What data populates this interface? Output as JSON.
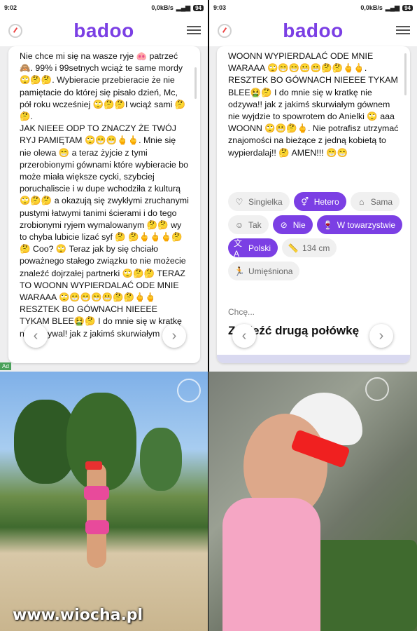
{
  "left": {
    "status": {
      "time": "9:02",
      "network": "0,0kB/s",
      "battery": "94"
    },
    "app_title": "badoo",
    "card_text": "Nie chce mi się na wasze ryje 🐽 patrzeć 🙈. 99% i 99setnych wciąż te same mordy 🙄🤔🤔. Wybieracie przebieracie że nie pamiętacie do której się pisało dzień, Mc, pół roku wcześniej 🙄🤔🤔I wciąż sami 🤔🤔.\nJAK NIEEE ODP TO ZNACZY ŻE TWÓJ RYJ PAMIĘTAM 🙄😁😁🖕🖕. Mnie się nie olewa 😁 a teraz żyjcie z tymi przerobionymi gównami które wybieracie bo może miała większe cycki, szybciej poruchaliscie i w dupe wchodziła z kulturą 🙄🤔🤔 a okazują się zwykłymi zruchanymi pustymi łatwymi tanimi ścierami i do tego zrobionymi ryjem wymalowanym 🤔🤔 wy to chyba lubicie lizać syf 🤔 🤔🖕🖕🖕🤔 🤔 Coo? 🙄 Teraz jak by się chciało poważnego stałego związku to nie możecie znaleźć dojrzałej partnerki 🙄🤔🤔 TERAZ TO WOONN WYPIERDALAĆ ODE MNIE WARAAA 🙄😁😁😁😬🤔🤔🖕🖕 RESZTEK BO GÓWNACH NIEEEE TYKAM BLEE🤮🤔 I do mnie się w kratkę nie odzywal! jak z jakimś skurwiałym",
    "ad_label": "Ad",
    "prev_icon": "chevron-left-icon",
    "next_icon": "chevron-right-icon"
  },
  "right": {
    "status": {
      "time": "9:03",
      "network": "0,0kB/s",
      "battery": "94"
    },
    "app_title": "badoo",
    "card_text": "WOONN WYPIERDALAĆ ODE MNIE WARAAA 🙄😁😁😬😬🤔🤔🖕🖕. RESZTEK BO GÓWNACH NIEEEE TYKAM BLEE🤮🤔 I do mnie się w kratkę nie odzywa!! jak z jakimś skurwiałym gównem nie wyjdzie to spowrotem do Anielki 🙄 aaa WOONN 🙄😬🤔🖕. Nie potrafisz utrzymać znajomości na bieżące z jedną kobietą to wypierdalaj!! 🤔 AMEN!!! 😁😁",
    "tags": [
      {
        "icon": "heart-icon",
        "glyph": "♡",
        "label": "Singielka",
        "active": false
      },
      {
        "icon": "gender-icon",
        "glyph": "⚥",
        "label": "Hetero",
        "active": true
      },
      {
        "icon": "house-icon",
        "glyph": "⌂",
        "label": "Sama",
        "active": false
      },
      {
        "icon": "smile-icon",
        "glyph": "☺",
        "label": "Tak",
        "active": false
      },
      {
        "icon": "no-smoking-icon",
        "glyph": "⊘",
        "label": "Nie",
        "active": true
      },
      {
        "icon": "glass-icon",
        "glyph": "🍷",
        "label": "W towarzystwie",
        "active": true
      },
      {
        "icon": "language-icon",
        "glyph": "文A",
        "label": "Polski",
        "active": true
      },
      {
        "icon": "ruler-icon",
        "glyph": "📏",
        "label": "134 cm",
        "active": false
      },
      {
        "icon": "body-icon",
        "glyph": "🏃",
        "label": "Umięśniona",
        "active": false
      }
    ],
    "wants_label": "Chcę...",
    "wants_value": "Znaleźć drugą połówkę"
  },
  "watermark": "www.wiocha.pl",
  "colors": {
    "accent": "#7b3fe4",
    "tag_bg": "#f0f0f0",
    "ad_green": "#4aa15a"
  }
}
